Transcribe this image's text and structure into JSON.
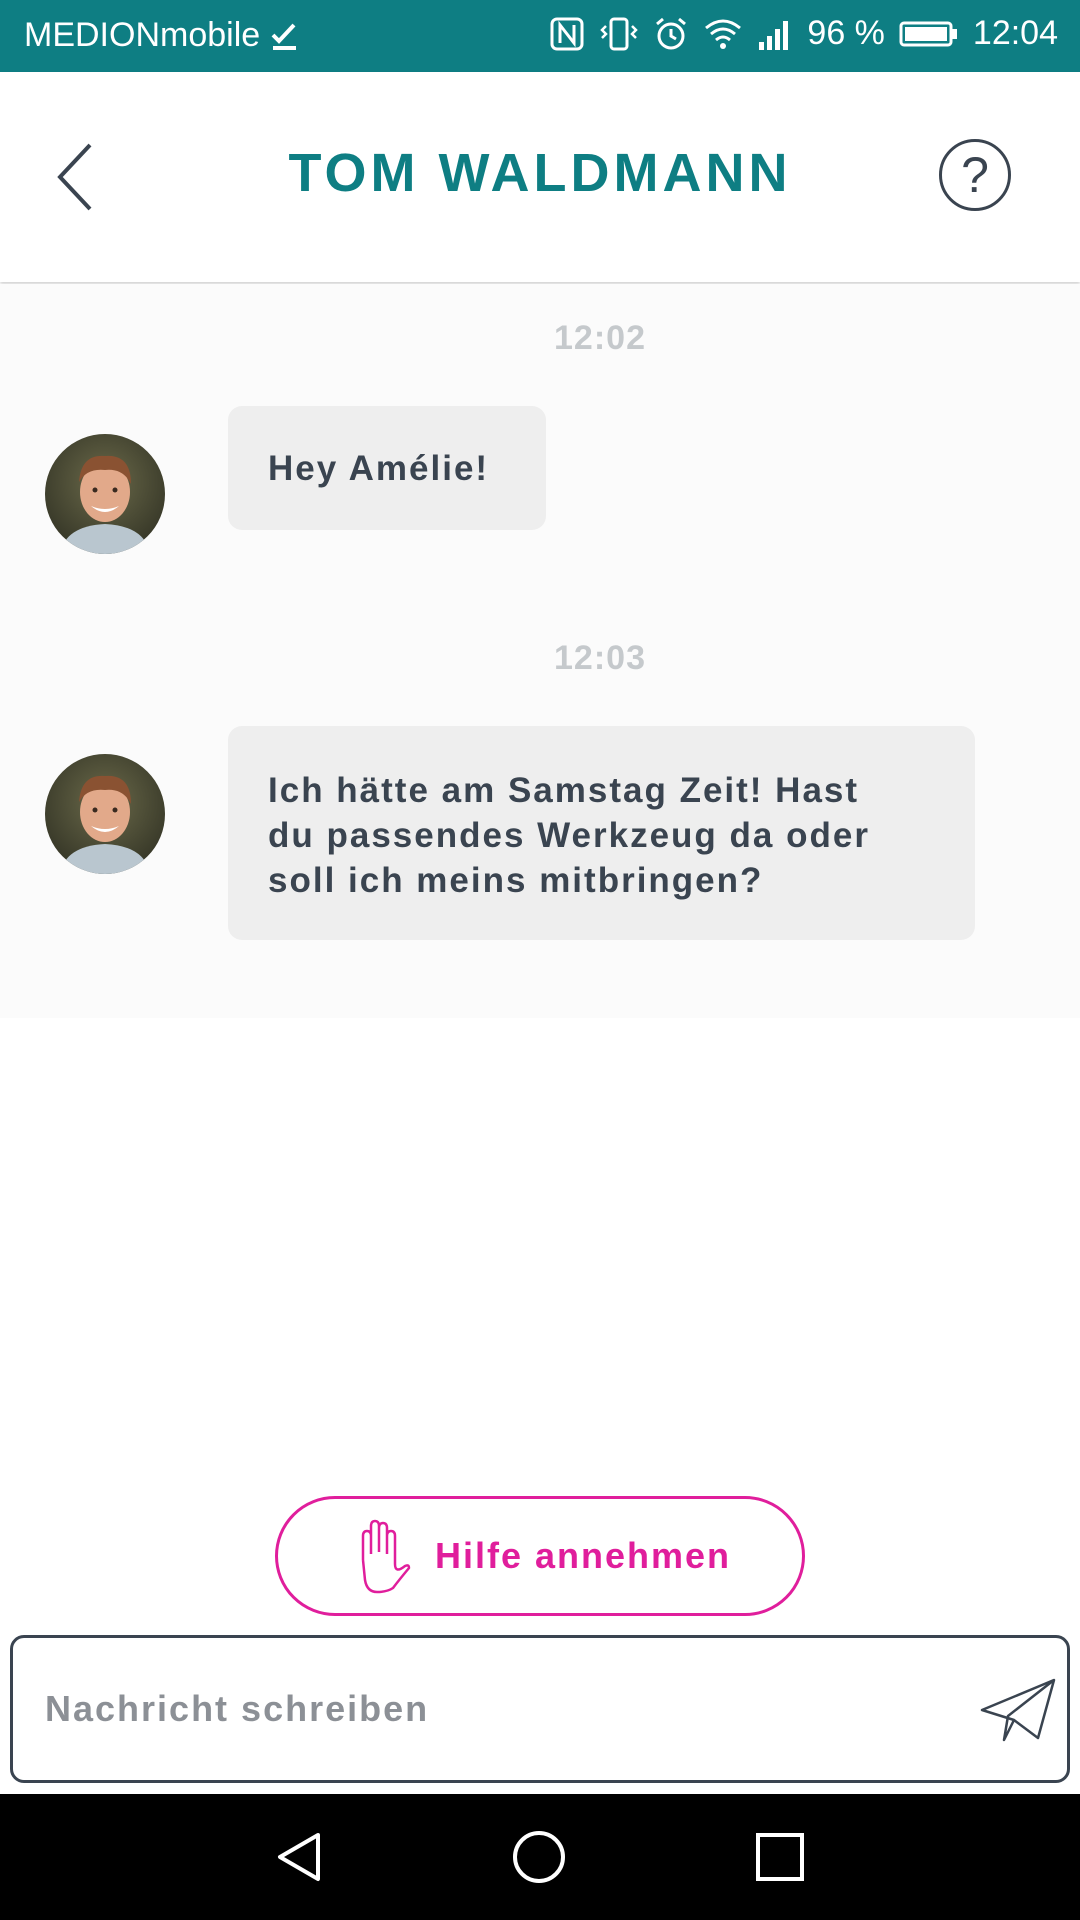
{
  "status_bar": {
    "carrier": "MEDIONmobile",
    "battery": "96 %",
    "time": "12:04",
    "icons": [
      "check-icon",
      "nfc-icon",
      "vibrate-icon",
      "alarm-icon",
      "wifi-icon",
      "signal-icon",
      "battery-icon"
    ]
  },
  "header": {
    "title": "TOM WALDMANN",
    "back_icon": "chevron-left-icon",
    "help_icon": "question-icon",
    "help_label": "?"
  },
  "messages": [
    {
      "time": "12:02",
      "text": "Hey Amélie!"
    },
    {
      "time": "12:03",
      "text_lines": [
        "Ich hätte am Samstag Zeit! Hast",
        "du passendes Werkzeug da oder",
        "soll ich meins mitbringen?"
      ]
    }
  ],
  "actions": {
    "accept_help_label": "Hilfe annehmen",
    "accept_help_icon": "hand-icon"
  },
  "composer": {
    "placeholder": "Nachricht schreiben",
    "value": "",
    "send_icon": "paper-plane-icon"
  },
  "colors": {
    "brand": "#0e7e83",
    "accent": "#e01e9c",
    "text": "#3a4450",
    "bubble": "#eeeeee"
  }
}
